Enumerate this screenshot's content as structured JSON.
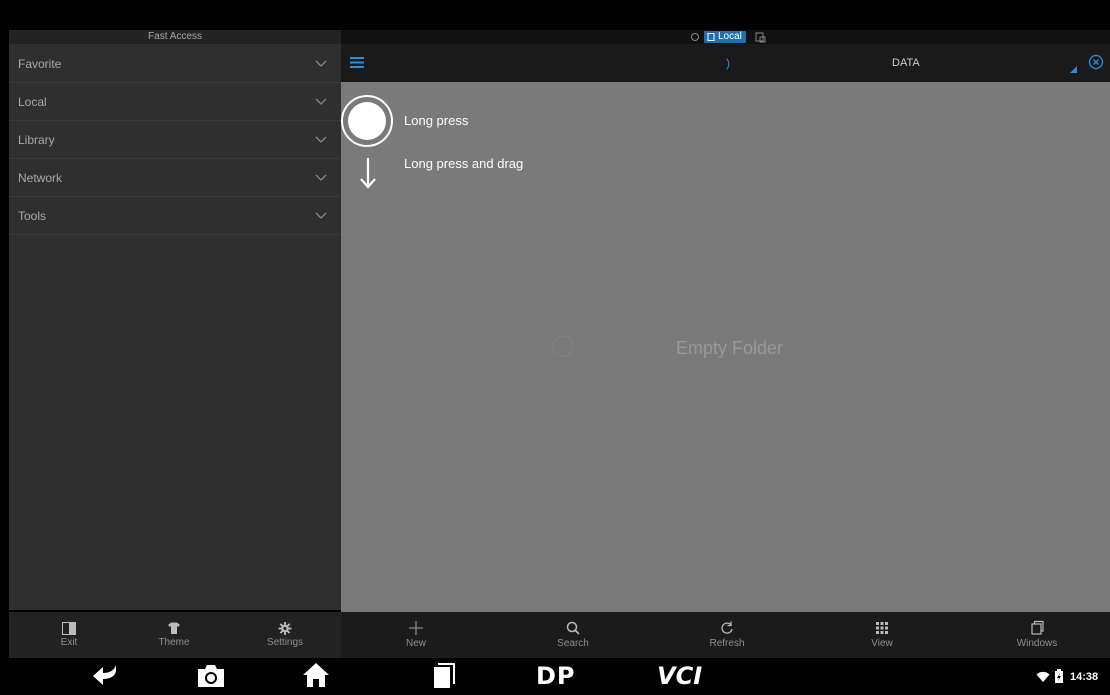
{
  "left_panel": {
    "title": "Fast Access",
    "items": [
      {
        "label": "Favorite"
      },
      {
        "label": "Local"
      },
      {
        "label": "Library"
      },
      {
        "label": "Network"
      },
      {
        "label": "Tools"
      }
    ],
    "actions": [
      {
        "label": "Exit",
        "icon": "exit-icon"
      },
      {
        "label": "Theme",
        "icon": "shirt-icon"
      },
      {
        "label": "Settings",
        "icon": "gear-icon"
      }
    ]
  },
  "header": {
    "location_badge": "Local",
    "folder_title": "DATA",
    "breadcrumb_sep": ")"
  },
  "main": {
    "empty_text": "Empty Folder",
    "hints": [
      {
        "label": "Long press"
      },
      {
        "label": "Long press and drag"
      }
    ]
  },
  "bottom_actions": [
    {
      "label": "New",
      "icon": "plus-icon"
    },
    {
      "label": "Search",
      "icon": "search-icon"
    },
    {
      "label": "Refresh",
      "icon": "refresh-icon"
    },
    {
      "label": "View",
      "icon": "grid-icon"
    },
    {
      "label": "Windows",
      "icon": "windows-icon"
    }
  ],
  "system_bar": {
    "time": "14:38",
    "brand_1": "DP",
    "brand_2": "VCI"
  },
  "colors": {
    "accent": "#1f6fb0",
    "panel_dark": "#2f2f2f",
    "content_grey": "#7a7a7a"
  }
}
